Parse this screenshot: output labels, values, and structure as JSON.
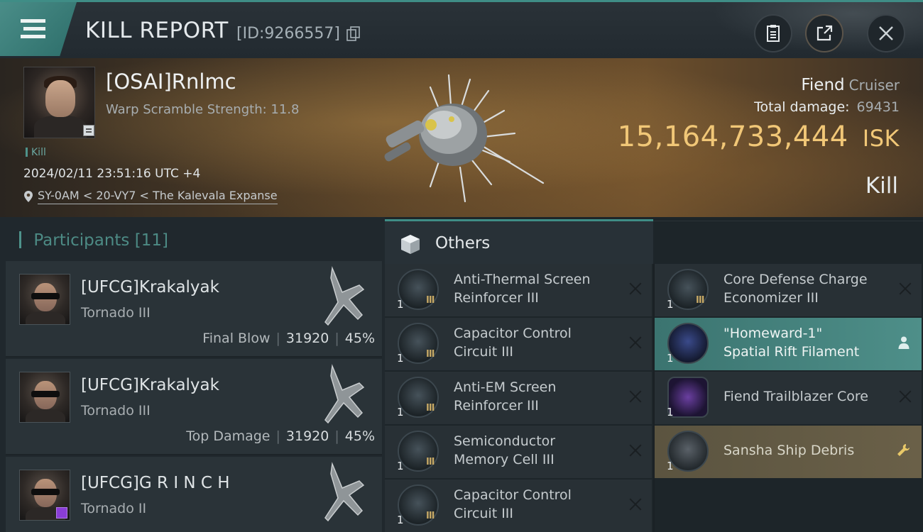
{
  "window": {
    "title": "KILL REPORT",
    "report_id": "[ID:9266557]"
  },
  "victim": {
    "name": "[OSAI]Rnlmc",
    "warp_scramble": "Warp Scramble Strength: 11.8",
    "tag": "Kill",
    "datetime": "2024/02/11 23:51:16 UTC +4",
    "location": "SY-0AM < 20-VY7 < The Kalevala Expanse",
    "ship_name": "Fiend",
    "ship_class": "Cruiser",
    "total_damage_label": "Total damage:",
    "total_damage": "69431",
    "isk_value": "15,164,733,444",
    "isk_unit": "ISK",
    "result": "Kill"
  },
  "participants": {
    "label": "Participants",
    "count": "[11]",
    "rows": [
      {
        "name": "[UFCG]Krakalyak",
        "ship": "Tornado III",
        "role": "Final Blow",
        "damage": "31920",
        "percent": "45%"
      },
      {
        "name": "[UFCG]Krakalyak",
        "ship": "Tornado III",
        "role": "Top Damage",
        "damage": "31920",
        "percent": "45%"
      },
      {
        "name": "[UFCG]G R I N C H",
        "ship": "Tornado II"
      }
    ]
  },
  "others": {
    "title": "Others",
    "items": [
      {
        "name_line1": "Anti-Thermal Screen",
        "name_line2": "Reinforcer III",
        "qty": "1",
        "meta": "III",
        "state": "destroyed"
      },
      {
        "name_line1": "Core Defense Charge",
        "name_line2": "Economizer III",
        "qty": "1",
        "meta": "III",
        "state": "destroyed"
      },
      {
        "name_line1": "Capacitor Control",
        "name_line2": "Circuit III",
        "qty": "1",
        "meta": "III",
        "state": "destroyed"
      },
      {
        "name_line1": "\"Homeward-1\"",
        "name_line2": "Spatial Rift Filament",
        "qty": "1",
        "meta": "",
        "state": "dropped-user"
      },
      {
        "name_line1": "Anti-EM Screen",
        "name_line2": "Reinforcer III",
        "qty": "1",
        "meta": "III",
        "state": "destroyed"
      },
      {
        "name_line1": "Fiend Trailblazer Core",
        "name_line2": "",
        "qty": "1",
        "meta": "",
        "state": "destroyed"
      },
      {
        "name_line1": "Semiconductor",
        "name_line2": "Memory Cell III",
        "qty": "1",
        "meta": "III",
        "state": "destroyed"
      },
      {
        "name_line1": "Sansha Ship Debris",
        "name_line2": "",
        "qty": "1",
        "meta": "",
        "state": "salvage"
      },
      {
        "name_line1": "Capacitor Control",
        "name_line2": "Circuit III",
        "qty": "1",
        "meta": "III",
        "state": "destroyed"
      }
    ]
  },
  "colors": {
    "accent_teal": "#3f8d86",
    "isk_gold": "#f1c777",
    "dropped_teal": "#4e8f89",
    "salvage_gold": "#6a6048"
  },
  "icons": [
    "menu-icon",
    "copy-icon",
    "clipboard-icon",
    "share-icon",
    "close-icon",
    "location-pin-icon",
    "cube-icon",
    "user-icon",
    "wrench-icon"
  ]
}
